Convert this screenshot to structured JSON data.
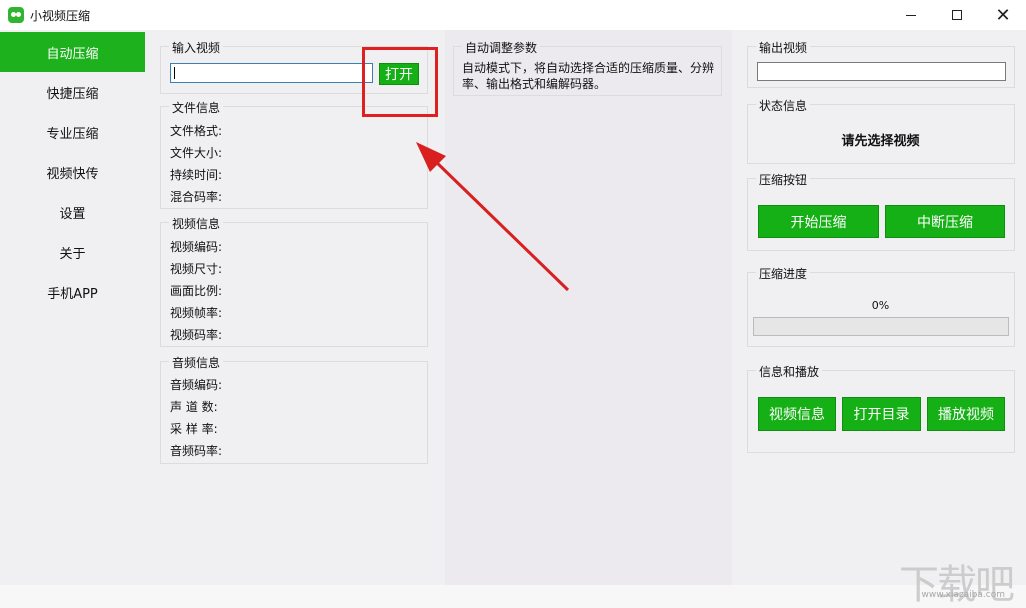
{
  "window": {
    "title": "小视频压缩",
    "controls": {
      "minimize": "",
      "maximize": "",
      "close": "✕"
    }
  },
  "sidebar": {
    "items": [
      {
        "label": "自动压缩",
        "active": true
      },
      {
        "label": "快捷压缩"
      },
      {
        "label": "专业压缩"
      },
      {
        "label": "视频快传"
      },
      {
        "label": "设置"
      },
      {
        "label": "关于"
      },
      {
        "label": "手机APP"
      }
    ]
  },
  "input_video": {
    "title": "输入视频",
    "value": "",
    "open_button": "打开"
  },
  "file_info": {
    "title": "文件信息",
    "fields": [
      "文件格式:",
      "文件大小:",
      "持续时间:",
      "混合码率:"
    ]
  },
  "video_info": {
    "title": "视频信息",
    "fields": [
      "视频编码:",
      "视频尺寸:",
      "画面比例:",
      "视频帧率:",
      "视频码率:"
    ]
  },
  "audio_info": {
    "title": "音频信息",
    "fields": [
      "音频编码:",
      "声 道 数:",
      "采 样 率:",
      "音频码率:"
    ]
  },
  "auto_params": {
    "title": "自动调整参数",
    "description": "自动模式下，将自动选择合适的压缩质量、分辨率、输出格式和编解码器。"
  },
  "output_video": {
    "title": "输出视频",
    "value": ""
  },
  "status": {
    "title": "状态信息",
    "message": "请先选择视频"
  },
  "compress_buttons": {
    "title": "压缩按钮",
    "start": "开始压缩",
    "stop": "中断压缩"
  },
  "progress": {
    "title": "压缩进度",
    "percent_label": "0%",
    "value": 0
  },
  "info_play": {
    "title": "信息和播放",
    "video_info": "视频信息",
    "open_dir": "打开目录",
    "play": "播放视频"
  },
  "watermark": {
    "big": "下载吧",
    "small": "www.xiazaiba.com"
  },
  "colors": {
    "accent": "#15b015",
    "highlight": "#e02020"
  }
}
